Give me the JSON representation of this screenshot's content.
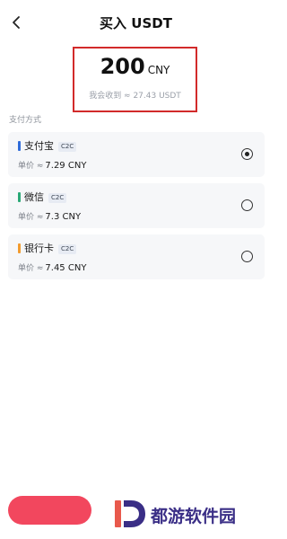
{
  "header": {
    "title": "买入 USDT",
    "back_icon": "chevron-left-icon"
  },
  "amount": {
    "value": "200",
    "currency": "CNY",
    "receive_text": "我会收到 ≈ 27.43 USDT"
  },
  "section_label": "支付方式",
  "payment_methods": [
    {
      "name": "支付宝",
      "badge": "C2C",
      "price_label": "单价 ≈",
      "price": "7.29 CNY",
      "accent": "#2f6bd9",
      "selected": true
    },
    {
      "name": "微信",
      "badge": "C2C",
      "price_label": "单价 ≈",
      "price": "7.3 CNY",
      "accent": "#2aa876",
      "selected": false
    },
    {
      "name": "银行卡",
      "badge": "C2C",
      "price_label": "单价 ≈",
      "price": "7.45 CNY",
      "accent": "#f29b2e",
      "selected": false
    }
  ],
  "buy_button": {
    "color": "#f2475e"
  },
  "watermark": {
    "text": "都游软件园",
    "color": "#3a2e86"
  }
}
